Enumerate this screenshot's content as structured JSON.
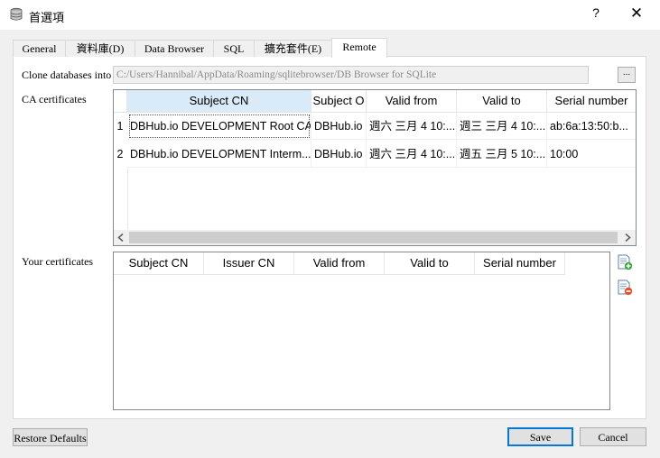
{
  "window": {
    "title": "首選項",
    "help": "?",
    "close": "✕"
  },
  "tabs": [
    {
      "label": "General"
    },
    {
      "label": "資料庫(D)"
    },
    {
      "label": "Data Browser"
    },
    {
      "label": "SQL"
    },
    {
      "label": "擴充套件(E)"
    },
    {
      "label": "Remote"
    }
  ],
  "remote": {
    "clone_label": "Clone databases into",
    "clone_path": "C:/Users/Hannibal/AppData/Roaming/sqlitebrowser/DB Browser for SQLite",
    "browse_label": "...",
    "ca_label": "CA certificates",
    "ca_columns": [
      "Subject CN",
      "Subject O",
      "Valid from",
      "Valid to",
      "Serial number"
    ],
    "ca_rows": [
      {
        "num": "1",
        "cells": [
          "DBHub.io DEVELOPMENT Root CA",
          "DBHub.io",
          "週六 三月 4 10:...",
          "週三 三月 4 10:...",
          "ab:6a:13:50:b..."
        ]
      },
      {
        "num": "2",
        "cells": [
          "DBHub.io DEVELOPMENT Interm...",
          "DBHub.io",
          "週六 三月 4 10:...",
          "週五 三月 5 10:...",
          "10:00"
        ]
      }
    ],
    "your_label": "Your certificates",
    "your_columns": [
      "Subject CN",
      "Issuer CN",
      "Valid from",
      "Valid to",
      "Serial number"
    ]
  },
  "buttons": {
    "restore": "Restore Defaults",
    "save": "Save",
    "cancel": "Cancel"
  },
  "icons": {
    "add_cert": "add-certificate-icon",
    "remove_cert": "remove-certificate-icon"
  }
}
